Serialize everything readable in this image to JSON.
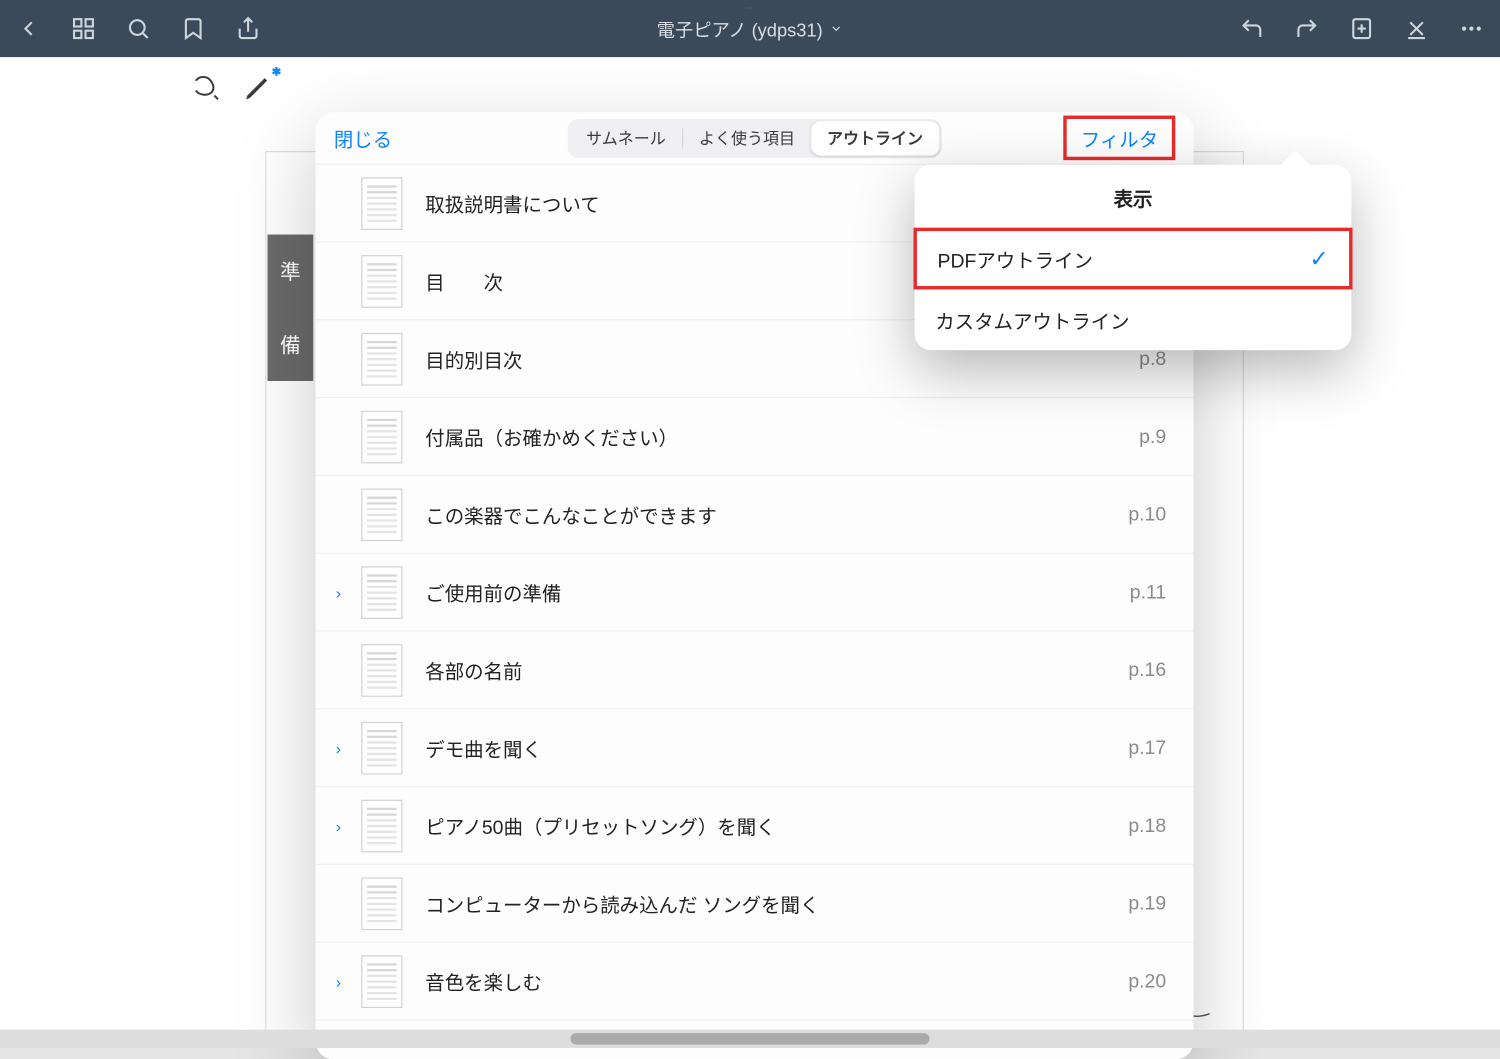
{
  "toolbar": {
    "title": "電子ピアノ (ydps31)"
  },
  "side_label": {
    "c1": "準",
    "c2": "備"
  },
  "panel": {
    "close": "閉じる",
    "seg": {
      "thumbnail": "サムネール",
      "favorites": "よく使う項目",
      "outline": "アウトライン"
    },
    "filter": "フィルタ"
  },
  "outline": [
    {
      "title": "取扱説明書について",
      "page": "",
      "expandable": false
    },
    {
      "title": "目　　次",
      "page": "",
      "expandable": false
    },
    {
      "title": "目的別目次",
      "page": "p.8",
      "expandable": false
    },
    {
      "title": "付属品（お確かめください）",
      "page": "p.9",
      "expandable": false
    },
    {
      "title": "この楽器でこんなことができます",
      "page": "p.10",
      "expandable": false
    },
    {
      "title": "ご使用前の準備",
      "page": "p.11",
      "expandable": true
    },
    {
      "title": "各部の名前",
      "page": "p.16",
      "expandable": false
    },
    {
      "title": "デモ曲を聞く",
      "page": "p.17",
      "expandable": true
    },
    {
      "title": "ピアノ50曲（プリセットソング）を聞く",
      "page": "p.18",
      "expandable": true
    },
    {
      "title": "コンピューターから読み込んだ ソングを聞く",
      "page": "p.19",
      "expandable": false
    },
    {
      "title": "音色を楽しむ",
      "page": "p.20",
      "expandable": true
    }
  ],
  "popover": {
    "header": "表示",
    "items": [
      {
        "label": "PDFアウトライン",
        "checked": true,
        "highlighted": true
      },
      {
        "label": "カスタムアウトライン",
        "checked": false,
        "highlighted": false
      }
    ]
  }
}
